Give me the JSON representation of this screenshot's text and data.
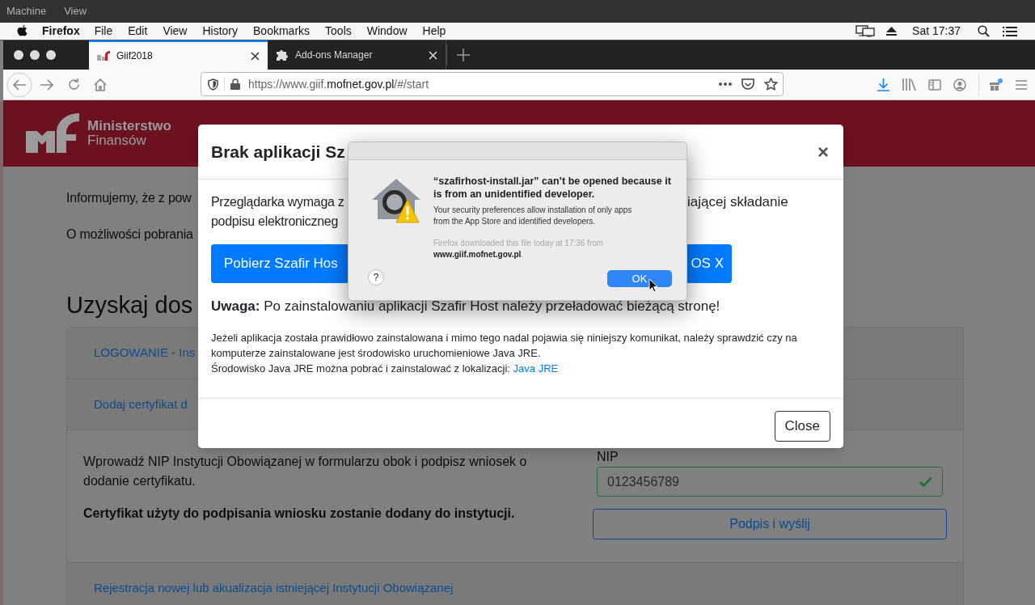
{
  "vm_menu": [
    "Machine",
    "View"
  ],
  "menu_bar": {
    "app": "Firefox",
    "items": [
      "File",
      "Edit",
      "View",
      "History",
      "Bookmarks",
      "Tools",
      "Window",
      "Help"
    ],
    "clock": "Sat 17:37"
  },
  "tabs": [
    {
      "title": "Giif2018",
      "selected": true
    },
    {
      "title": "Add-ons Manager",
      "selected": false
    }
  ],
  "address": {
    "prefix": "https://www.giif.",
    "domain": "mofnet.gov.pl",
    "suffix": "/#/start"
  },
  "page": {
    "logo_top": "Ministerstwo",
    "logo_bottom": "Finansów",
    "paragraphs": [
      "Informujemy, że z pow",
      "O możliwości pobrania"
    ],
    "heading": "Uzyskaj dos",
    "sections": [
      {
        "kind": "collapsed",
        "title": "LOGOWANIE - Ins"
      },
      {
        "kind": "form",
        "title": "Dodaj certyfikat d",
        "description": "Wprowadź NIP Instytucji Obowiązanej w formularzu obok i podpisz wniosek o dodanie certyfikatu.",
        "note": "Certyfikat użyty do podpisania wniosku zostanie dodany do instytucji.",
        "field_label": "NIP",
        "field_value": "0123456789",
        "valid": true,
        "button": "Podpis i wyślij"
      },
      {
        "kind": "collapsed",
        "title": "Rejestracja nowej lub akualizacja istniejącej Instytucji Obowiązanej"
      }
    ]
  },
  "modal": {
    "title": "Brak aplikacji Sz",
    "close": "×",
    "intro_left": "Przeglądarka wymaga z",
    "intro_right": "iającej składanie",
    "intro_line2": "podpisu elektroniczneg",
    "button_left": "Pobierz Szafir Hos",
    "button_right": "OS X",
    "warning": "**Uwaga:** Po zainstalowaniu aplikacji Szafir Host należy przeładować bieżącą stronę!",
    "details": [
      "Jeżeli aplikacja została prawidłowo zainstalowana i mimo tego nadal pojawia się niniejszy komunikat, należy sprawdzić czy na komputerze zainstalowane jest środowisko uruchomieniowe Java JRE.",
      "Środowisko Java JRE można pobrać i zainstalować z lokalizacji:"
    ],
    "link": "Java JRE",
    "footer_button": "Close"
  },
  "dialog": {
    "title": "“szafirhost-install.jar” can’t be opened because it is from an unidentified developer.",
    "message": "Your security preferences allow installation of only apps from the App Store and identified developers.",
    "source": "Firefox downloaded this file today at 17:36 from",
    "source_domain": "www.giif.mofnet.gov.pl",
    "source_end": ".",
    "help": "?",
    "button": "OK"
  }
}
